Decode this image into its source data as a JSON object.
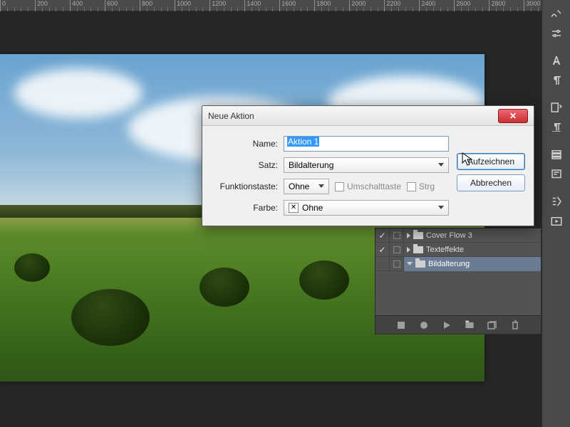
{
  "ruler_ticks": [
    0,
    200,
    400,
    600,
    800,
    1000,
    1200,
    1400,
    1600,
    1800,
    2000,
    2200,
    2400,
    2600,
    2800,
    3000
  ],
  "dialog": {
    "title": "Neue Aktion",
    "labels": {
      "name": "Name:",
      "set": "Satz:",
      "fkey": "Funktionstaste:",
      "color": "Farbe:"
    },
    "name_value": "Aktion 1",
    "set_value": "Bildalterung",
    "fkey_value": "Ohne",
    "shift_label": "Umschalttaste",
    "ctrl_label": "Strg",
    "color_value": "Ohne",
    "record_btn": "Aufzeichnen",
    "cancel_btn": "Abbrechen"
  },
  "actions_panel": {
    "rows": [
      {
        "checked": true,
        "toggle": false,
        "expand": "right",
        "label": "Cover Flow 3"
      },
      {
        "checked": true,
        "toggle": false,
        "expand": "right",
        "label": "Texteffekte"
      },
      {
        "checked": false,
        "toggle": true,
        "expand": "down",
        "label": "Bildalterung",
        "selected": true
      }
    ]
  }
}
